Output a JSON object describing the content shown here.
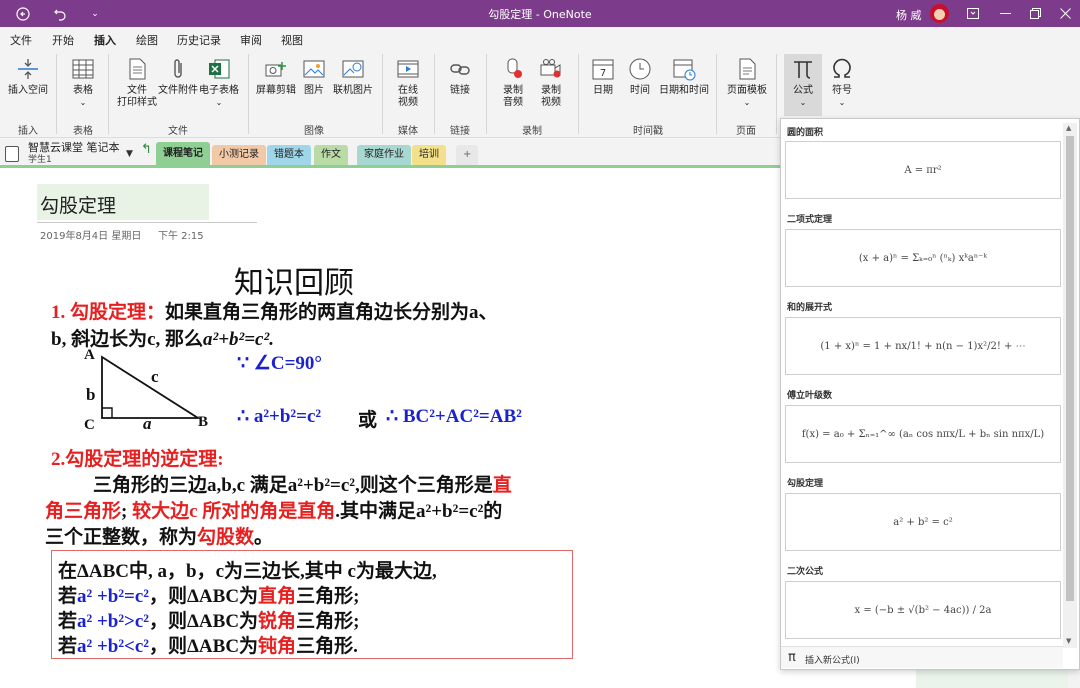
{
  "window": {
    "title": "勾股定理 - OneNote",
    "user": "杨 威"
  },
  "menu": {
    "tabs": [
      "文件",
      "开始",
      "插入",
      "绘图",
      "历史记录",
      "审阅",
      "视图"
    ],
    "active": "插入"
  },
  "ribbon": {
    "insert_space": "插入空间",
    "table": "表格",
    "file_print": "文件\n打印样式",
    "file_attach": "文件附件",
    "spreadsheet": "电子表格",
    "screen_clip": "屏幕剪辑",
    "picture": "图片",
    "online_picture": "联机图片",
    "online_video": "在线\n视频",
    "link": "链接",
    "record_audio": "录制\n音频",
    "record_video": "录制\n视频",
    "date": "日期",
    "time": "时间",
    "date_time": "日期和时间",
    "page_template": "页面模板",
    "equation": "公式",
    "symbol": "符号",
    "groups": {
      "insert": "插入",
      "tables": "表格",
      "files": "文件",
      "images": "图像",
      "media": "媒体",
      "links": "链接",
      "recording": "录制",
      "timestamp": "时间戳",
      "pages": "页面"
    }
  },
  "notebook": {
    "name": "智慧云课堂 笔记本",
    "section_group": "学生1",
    "sections": [
      {
        "label": "课程笔记",
        "color": "#8fcf94"
      },
      {
        "label": "小测记录",
        "color": "#f2c9a6"
      },
      {
        "label": "错题本",
        "color": "#9fd6ea"
      },
      {
        "label": "作文",
        "color": "#b9dca6"
      },
      {
        "label": "家庭作业",
        "color": "#a8d8d2"
      },
      {
        "label": "培训",
        "color": "#f3e08a"
      }
    ],
    "add": "+"
  },
  "page": {
    "title": "勾股定理",
    "date": "2019年8月4日 星期日",
    "time": "下午 2:15",
    "heading": "知识回顾",
    "p1_label": "1. 勾股定理：",
    "p1_text": "如果直角三角形的两直角边长分别为a、",
    "p1_text2a": "b, 斜边长为c, 那么",
    "p1_formula": "a²+b²=c².",
    "tri": {
      "A": "A",
      "B": "B",
      "C": "C",
      "a": "a",
      "b": "b",
      "c": "c"
    },
    "because": "∵ ∠C=90°",
    "therefore1": "∴ a²+b²=c²",
    "or": "或",
    "therefore2": "∴ BC²+AC²=AB²",
    "p2_label": "2.勾股定理的逆定理:",
    "p2_line1a": "三角形的三边a,b,c 满足a²+b²=c²,则这个三角形是",
    "p2_line1b": "直",
    "p2_line2a": "角三角形",
    "p2_line2b": "; ",
    "p2_line2c": "较大边c 所对的角是直角",
    "p2_line2d": ".其中满足a²+b²=c²的",
    "p2_line3a": "三个正整数，称为",
    "p2_line3b": "勾股数",
    "p2_line3c": "。",
    "box": {
      "l1": "在ΔABC中, a，b，c为三边长,其中 c为最大边,",
      "l2a": "若",
      "l2b": "a² +b²=c²",
      "l2c": "，则ΔABC为",
      "l2d": "直角",
      "l2e": "三角形;",
      "l3a": "若",
      "l3b": "a² +b²>c²",
      "l3c": "，则ΔABC为",
      "l3d": "锐角",
      "l3e": "三角形;",
      "l4a": "若",
      "l4b": "a² +b²<c²",
      "l4c": "，则ΔABC为",
      "l4d": "钝角",
      "l4e": "三角形."
    }
  },
  "equations": {
    "items": [
      {
        "label": "圆的面积",
        "formula": "A = πr²"
      },
      {
        "label": "二项式定理",
        "formula": "(x + a)ⁿ = Σₖ₌₀ⁿ (ⁿₖ) xᵏaⁿ⁻ᵏ"
      },
      {
        "label": "和的展开式",
        "formula": "(1 + x)ⁿ = 1 + nx/1! + n(n − 1)x²/2! + ⋯"
      },
      {
        "label": "傅立叶级数",
        "formula": "f(x) = a₀ + Σₙ₌₁^∞ (aₙ cos nπx/L + bₙ sin nπx/L)"
      },
      {
        "label": "勾股定理",
        "formula": "a² + b² = c²"
      },
      {
        "label": "二次公式",
        "formula": "x = (−b ± √(b² − 4ac)) / 2a"
      }
    ],
    "insert_new": "插入新公式(I)"
  }
}
